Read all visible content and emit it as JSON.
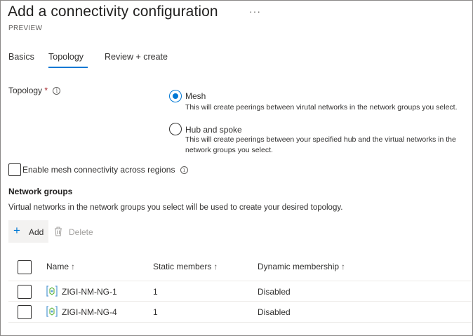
{
  "header": {
    "title": "Add a connectivity configuration",
    "more": "···",
    "subtitle": "PREVIEW"
  },
  "tabs": [
    {
      "label": "Basics",
      "active": false
    },
    {
      "label": "Topology",
      "active": true
    },
    {
      "label": "Review + create",
      "active": false
    }
  ],
  "topology": {
    "label": "Topology",
    "required_marker": "*",
    "info": "i",
    "options": [
      {
        "label": "Mesh",
        "description": "This will create peerings between virutal networks in the network groups you select.",
        "selected": true
      },
      {
        "label": "Hub and spoke",
        "description_line1": "This will create peerings between your specified hub and the virtual networks in the",
        "description_line2": "network groups you select.",
        "selected": false
      }
    ]
  },
  "global_mesh": {
    "label": "Enable mesh connectivity across regions",
    "checked": false
  },
  "network_groups": {
    "title": "Network groups",
    "description": "Virtual networks in the network groups you select will be used to create your desired topology.",
    "toolbar": {
      "add_label": "Add",
      "delete_label": "Delete"
    },
    "columns": [
      {
        "label": "Name",
        "sort": "↑"
      },
      {
        "label": "Static members",
        "sort": "↑"
      },
      {
        "label": "Dynamic membership",
        "sort": "↑"
      }
    ],
    "rows": [
      {
        "name": "ZIGI-NM-NG-1",
        "static_members": "1",
        "dynamic_membership": "Disabled"
      },
      {
        "name": "ZIGI-NM-NG-4",
        "static_members": "1",
        "dynamic_membership": "Disabled"
      }
    ]
  },
  "colors": {
    "accent": "#0078d4",
    "network_group_icon": "#5ea0d6",
    "network_group_icon_accent": "#5db43a"
  }
}
